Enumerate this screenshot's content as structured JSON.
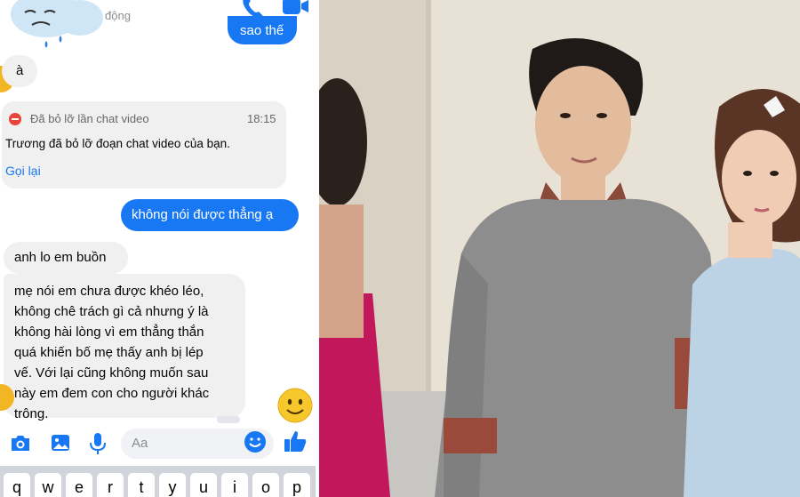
{
  "header": {
    "status_text": "động"
  },
  "messages": {
    "outgoing_top": "sao thế",
    "incoming_a": "à",
    "missed_call": {
      "title": "Đã bỏ lỡ lần chat video",
      "time": "18:15",
      "body": "Trương đã bỏ lỡ đoạn chat video của bạn.",
      "action": "Gọi lại"
    },
    "outgoing_khong": "không nói được thẳng ạ",
    "incoming_lo": "anh lo em buồn",
    "incoming_long": [
      "mẹ nói em chưa được khéo léo,",
      "không chê trách gì cả nhưng ý là",
      "không hài lòng vì em thẳng thắn",
      "quá khiến bố mẹ thấy anh bị lép",
      "vế. Với lại cũng không muốn sau",
      "này em đem con cho người khác",
      "trông."
    ]
  },
  "composer": {
    "placeholder": "Aa"
  },
  "keyboard": {
    "keys": [
      "q",
      "w",
      "e",
      "r",
      "t",
      "y",
      "u",
      "i",
      "o",
      "p"
    ]
  },
  "colors": {
    "messenger_blue": "#1877f2",
    "bubble_gray": "#f0f0f0",
    "missed_red": "#e8443a"
  },
  "icons": [
    "cloud-sad-icon",
    "phone-icon",
    "video-icon",
    "camera-icon",
    "gallery-icon",
    "microphone-icon",
    "emoji-icon",
    "thumbs-up-icon",
    "smile-emoji-icon"
  ]
}
